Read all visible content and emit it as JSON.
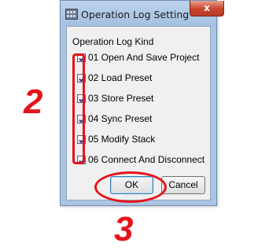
{
  "dialog": {
    "title": "Operation Log Setting",
    "close_glyph": "x",
    "group_label": "Operation Log Kind",
    "items": [
      {
        "label": "01 Open And Save Project",
        "checked": true
      },
      {
        "label": "02 Load Preset",
        "checked": true
      },
      {
        "label": "03 Store Preset",
        "checked": true
      },
      {
        "label": "04 Sync Preset",
        "checked": true
      },
      {
        "label": "05 Modify Stack",
        "checked": true
      },
      {
        "label": "06 Connect And Disconnect",
        "checked": true
      }
    ],
    "ok_label": "OK",
    "cancel_label": "Cancel"
  },
  "annotations": {
    "step_2": "2",
    "step_3": "3",
    "color": "#e5141b"
  },
  "colors": {
    "titlebar": "#aac4e2",
    "close_button": "#c8452d",
    "client_background": "#f0f0f0"
  }
}
